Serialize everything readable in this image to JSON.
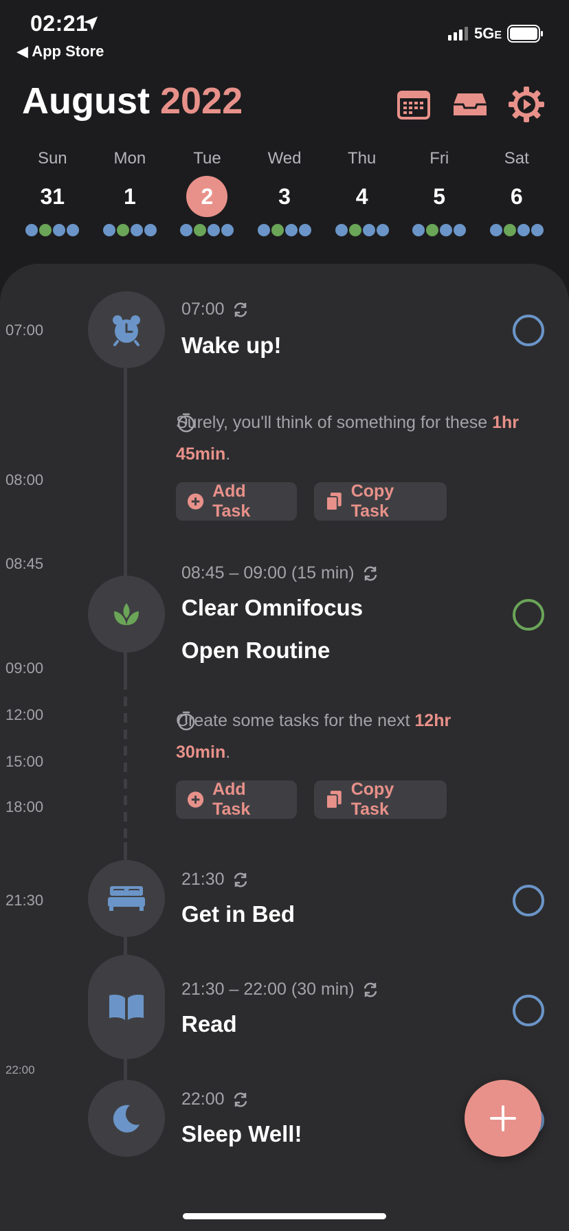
{
  "status_bar": {
    "time": "02:21",
    "back_label": "◀ App Store",
    "network": "5G",
    "network_suffix": "E"
  },
  "header": {
    "month": "August",
    "year": "2022",
    "icons": [
      "calendar-icon",
      "inbox-icon",
      "settings-icon"
    ]
  },
  "colors": {
    "accent": "#e8918a",
    "blue": "#6b95c8",
    "green": "#6aa558",
    "panel": "#2c2c2e",
    "background": "#1c1c1e"
  },
  "week": {
    "days": [
      {
        "dow": "Sun",
        "num": "31",
        "selected": false
      },
      {
        "dow": "Mon",
        "num": "1",
        "selected": false
      },
      {
        "dow": "Tue",
        "num": "2",
        "selected": true
      },
      {
        "dow": "Wed",
        "num": "3",
        "selected": false
      },
      {
        "dow": "Thu",
        "num": "4",
        "selected": false
      },
      {
        "dow": "Fri",
        "num": "5",
        "selected": false
      },
      {
        "dow": "Sat",
        "num": "6",
        "selected": false
      }
    ],
    "dot_icons": [
      "alarm-icon",
      "leaf-icon",
      "bed-icon",
      "book-icon"
    ]
  },
  "time_labels": [
    "07:00",
    "08:00",
    "08:45",
    "09:00",
    "12:00",
    "15:00",
    "18:00",
    "21:30",
    "22:00"
  ],
  "tasks": [
    {
      "time": "07:00",
      "title": "Wake up!",
      "icon": "alarm-icon"
    },
    {
      "time": "08:45 – 09:00 (15 min)",
      "title": "Clear Omnifocus",
      "title2": "Open Routine",
      "icon": "leaf-icon"
    },
    {
      "time": "21:30",
      "title": "Get in Bed",
      "icon": "bed-icon"
    },
    {
      "time": "21:30 – 22:00 (30 min)",
      "title": "Read",
      "icon": "book-icon"
    },
    {
      "time": "22:00",
      "title": "Sleep Well!",
      "icon": "moon-icon"
    }
  ],
  "gaps": [
    {
      "text": "Surely, you'll think of something for these ",
      "highlight": "1hr 45min",
      "suffix": "."
    },
    {
      "text": "Create some tasks for the next ",
      "highlight": "12hr 30min",
      "suffix": "."
    }
  ],
  "actions": {
    "add_task": "Add Task",
    "copy_task": "Copy Task"
  }
}
